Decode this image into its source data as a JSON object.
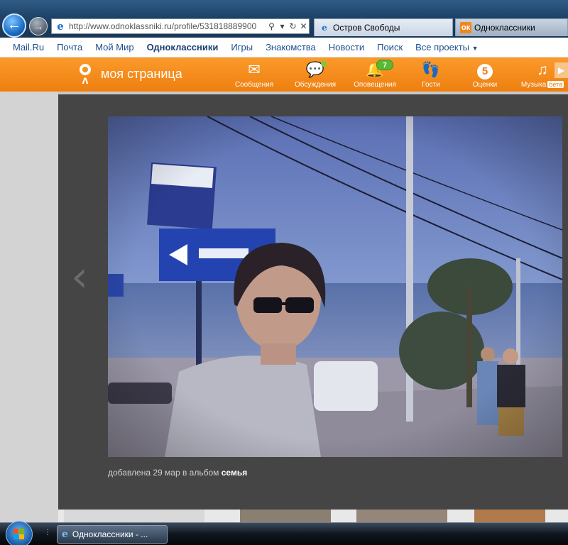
{
  "browser": {
    "address_url": "http://www.odnoklassniki.ru/profile/531818889900",
    "tabs": [
      {
        "title": "Остров Свободы"
      },
      {
        "title": "Одноклассники"
      }
    ]
  },
  "portal": {
    "links": [
      {
        "label": "Mail.Ru"
      },
      {
        "label": "Почта"
      },
      {
        "label": "Мой Мир"
      },
      {
        "label": "Одноклассники"
      },
      {
        "label": "Игры"
      },
      {
        "label": "Знакомства"
      },
      {
        "label": "Новости"
      },
      {
        "label": "Поиск"
      },
      {
        "label": "Все проекты"
      }
    ]
  },
  "okbar": {
    "title": "моя страница",
    "items": [
      {
        "label": "Сообщения",
        "icon": "envelope-icon"
      },
      {
        "label": "Обсуждения",
        "icon": "speech-bubbles-icon"
      },
      {
        "label": "Оповещения",
        "icon": "bell-icon",
        "badge": "7"
      },
      {
        "label": "Гости",
        "icon": "footprints-icon"
      },
      {
        "label": "Оценки",
        "icon": "rating-five-icon",
        "glyph": "5"
      },
      {
        "label": "Музыка",
        "icon": "music-note-icon",
        "tag": "бета"
      }
    ]
  },
  "photo": {
    "caption_prefix": "добавлена 29 мар в альбом",
    "album": "семья"
  },
  "taskbar": {
    "task_label": "Одноклассники - ..."
  },
  "colors": {
    "ok_orange": "#f28a1c",
    "overlay": "#454545",
    "link_blue": "#1b4f8f"
  }
}
